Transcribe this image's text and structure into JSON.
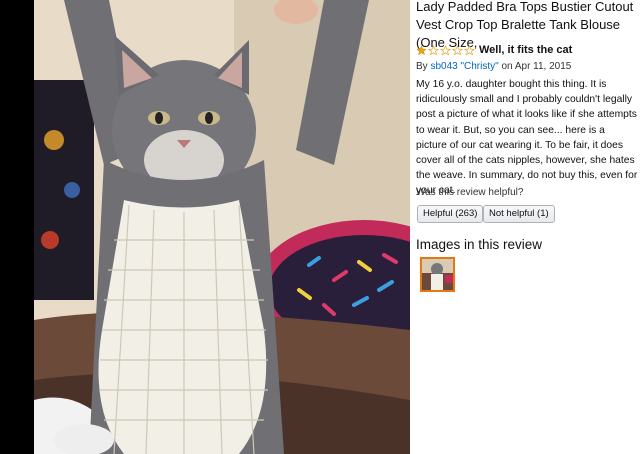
{
  "product": {
    "title": "Lady Padded Bra Tops Bustier Cutout Vest Crop Top Bralette Tank Blouse (One Size,"
  },
  "review": {
    "rating": 1,
    "rating_max": 5,
    "headline": "Well, it fits the cat",
    "by_prefix": "By",
    "author": "sb043 \"Christy\"",
    "date": "on Apr 11, 2015",
    "body": "My 16 y.o. daughter bought this thing. It is ridiculously small and I probably couldn't legally post a picture of what it looks like if she attempts to wear it. But, so you can see... here is a picture of our cat wearing it. To be fair, it does cover all of the cats nipples, however, she hates the weave. In summary, do not buy this, even for your cat."
  },
  "helpful": {
    "question": "Was this review helpful?",
    "yes_label": "Helpful (263)",
    "no_label": "Not helpful (1)"
  },
  "images_section": {
    "heading": "Images in this review"
  },
  "colors": {
    "star_filled": "#f0a500",
    "star_empty_stroke": "#e0a020",
    "link": "#0066c0",
    "thumb_border": "#e47911"
  }
}
